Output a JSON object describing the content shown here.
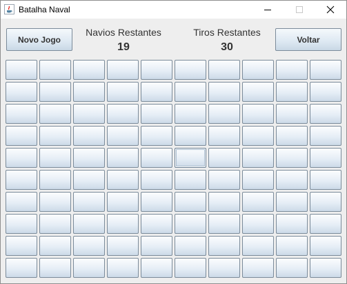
{
  "window": {
    "title": "Batalha Naval"
  },
  "toolbar": {
    "new_game_label": "Novo Jogo",
    "back_label": "Voltar"
  },
  "stats": {
    "ships_label": "Navios Restantes",
    "ships_value": "19",
    "shots_label": "Tiros Restantes",
    "shots_value": "30"
  },
  "board": {
    "rows": 10,
    "cols": 10,
    "focused_cell": {
      "row": 4,
      "col": 5
    }
  }
}
